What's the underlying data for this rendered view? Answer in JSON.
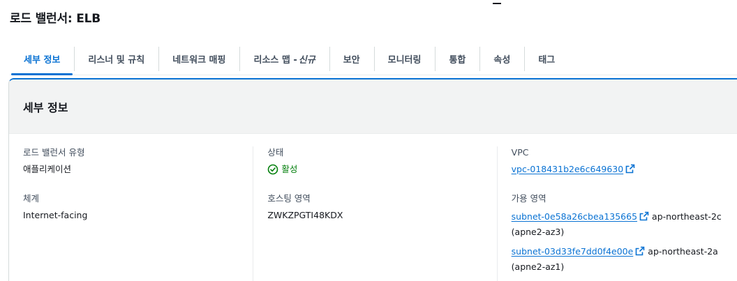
{
  "page": {
    "title": "로드 밸런서: ELB"
  },
  "tabs": [
    {
      "label": "세부 정보"
    },
    {
      "label": "리스너 및 규칙"
    },
    {
      "label": "네트워크 매핑"
    },
    {
      "label": "리소스 맵 - ",
      "tag": "신규"
    },
    {
      "label": "보안"
    },
    {
      "label": "모니터링"
    },
    {
      "label": "통합"
    },
    {
      "label": "속성"
    },
    {
      "label": "태그"
    }
  ],
  "details": {
    "heading": "세부 정보",
    "lb_type_label": "로드 밸런서 유형",
    "lb_type_value": "애플리케이션",
    "scheme_label": "체계",
    "scheme_value": "Internet-facing",
    "state_label": "상태",
    "state_value": "활성",
    "hosted_zone_label": "호스팅 영역",
    "hosted_zone_value": "ZWKZPGTI48KDX",
    "vpc_label": "VPC",
    "vpc_value": "vpc-018431b2e6c649630",
    "az_label": "가용 영역",
    "subnets": [
      {
        "id": "subnet-0e58a26cbea135665",
        "zone": "ap-northeast-2c (apne2-az3)"
      },
      {
        "id": "subnet-03d33fe7dd0f4e00e",
        "zone": "ap-northeast-2a (apne2-az1)"
      }
    ]
  },
  "colors": {
    "accent": "#0972d3",
    "success": "#037f0c"
  }
}
